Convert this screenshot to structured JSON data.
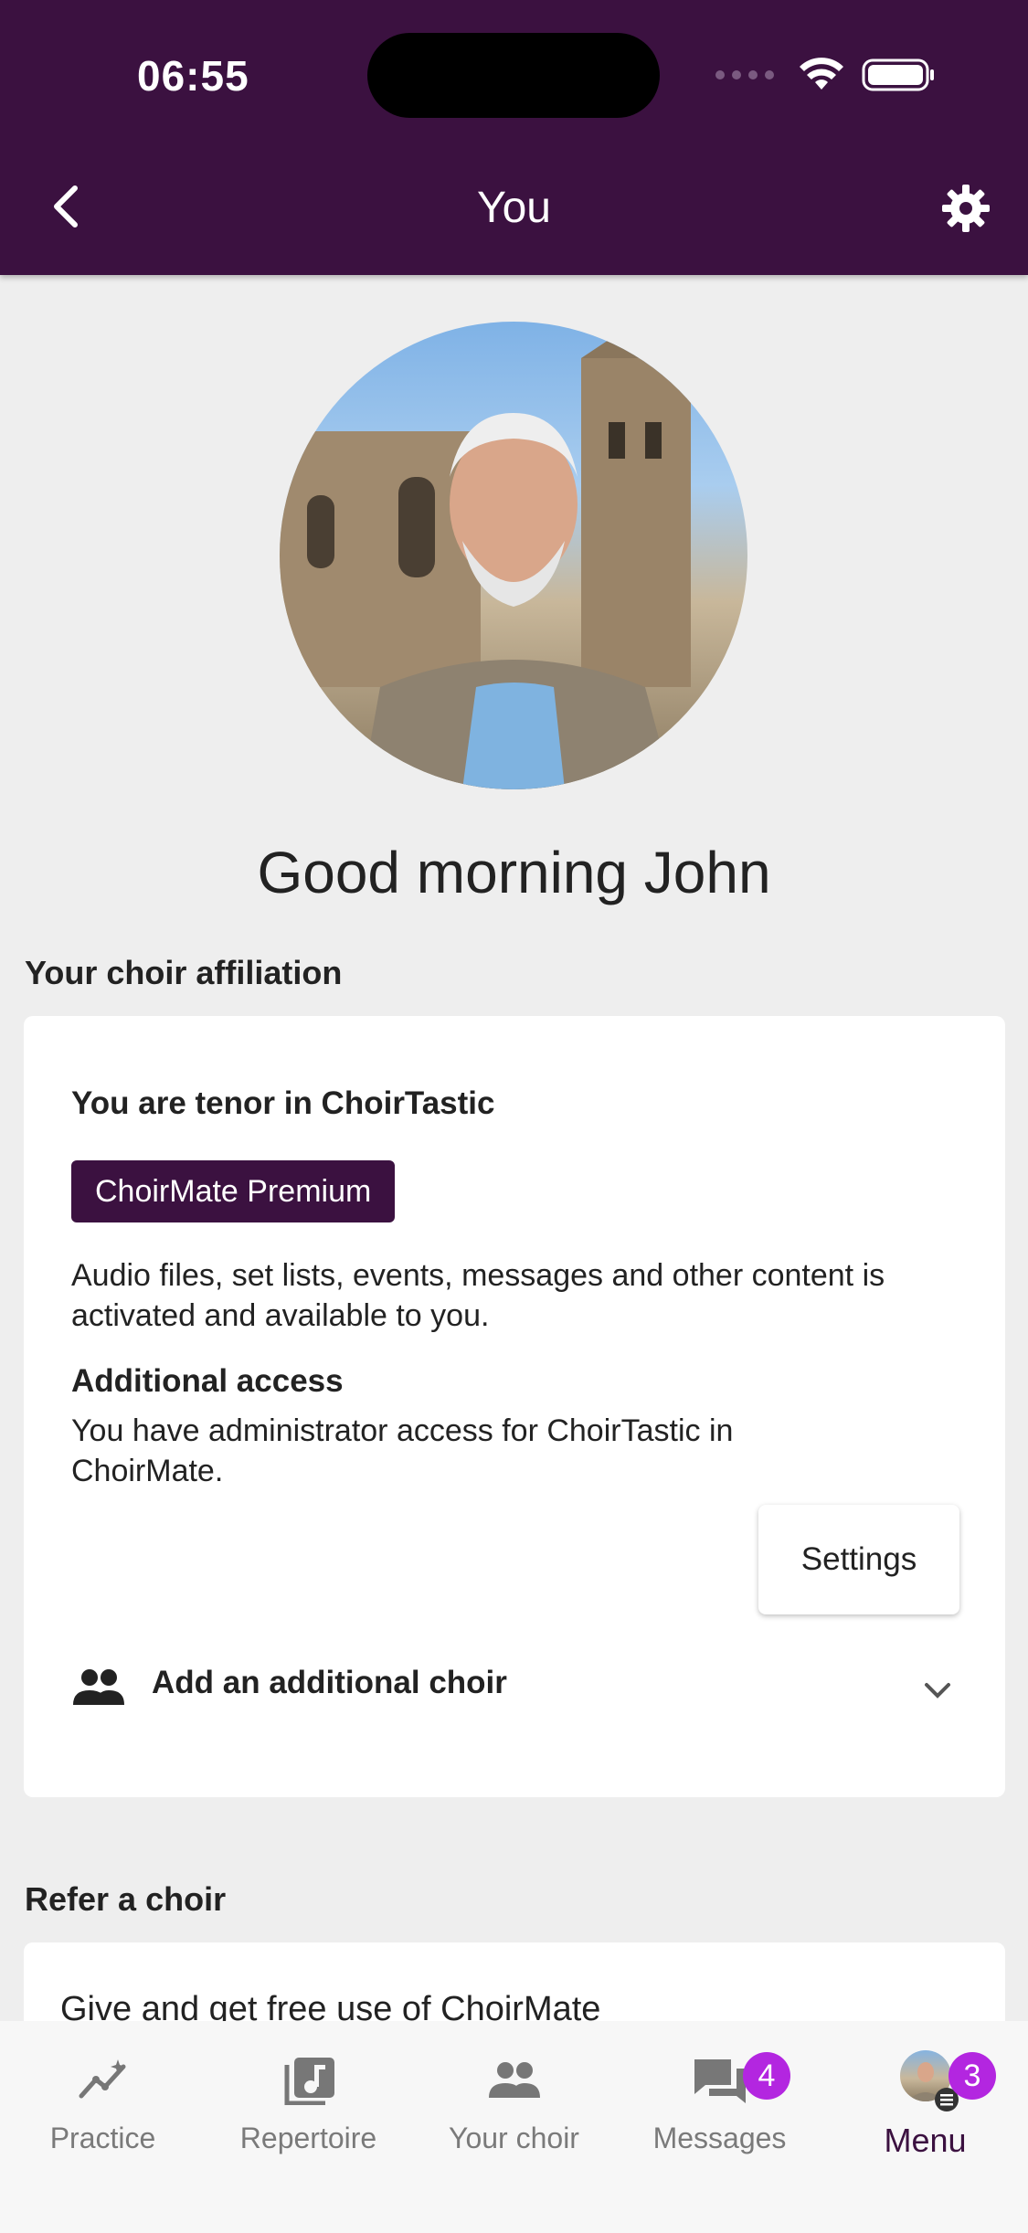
{
  "status_bar": {
    "time": "06:55"
  },
  "header": {
    "title": "You",
    "back_icon": "chevron-left-icon",
    "settings_icon": "gear-icon"
  },
  "profile": {
    "greeting": "Good morning John"
  },
  "affiliation": {
    "section_title": "Your choir affiliation",
    "role_text": "You are tenor in ChoirTastic",
    "badge": "ChoirMate Premium",
    "description": "Audio files, set lists, events, messages and other content is activated and available to you.",
    "additional_title": "Additional access",
    "additional_text": "You have administrator access for ChoirTastic in ChoirMate.",
    "settings_button": "Settings",
    "add_choir": "Add an additional choir"
  },
  "refer": {
    "section_title": "Refer a choir",
    "text": "Give and get free use of ChoirMate"
  },
  "bottom_nav": {
    "items": [
      {
        "label": "Practice",
        "icon": "practice-chart-icon"
      },
      {
        "label": "Repertoire",
        "icon": "music-note-icon"
      },
      {
        "label": "Your choir",
        "icon": "people-icon"
      },
      {
        "label": "Messages",
        "icon": "chat-icon",
        "badge": "4"
      },
      {
        "label": "Menu",
        "icon": "avatar",
        "badge": "3"
      }
    ]
  },
  "colors": {
    "brand": "#3b1140",
    "badge": "#b326e0",
    "background": "#eeeeee"
  }
}
